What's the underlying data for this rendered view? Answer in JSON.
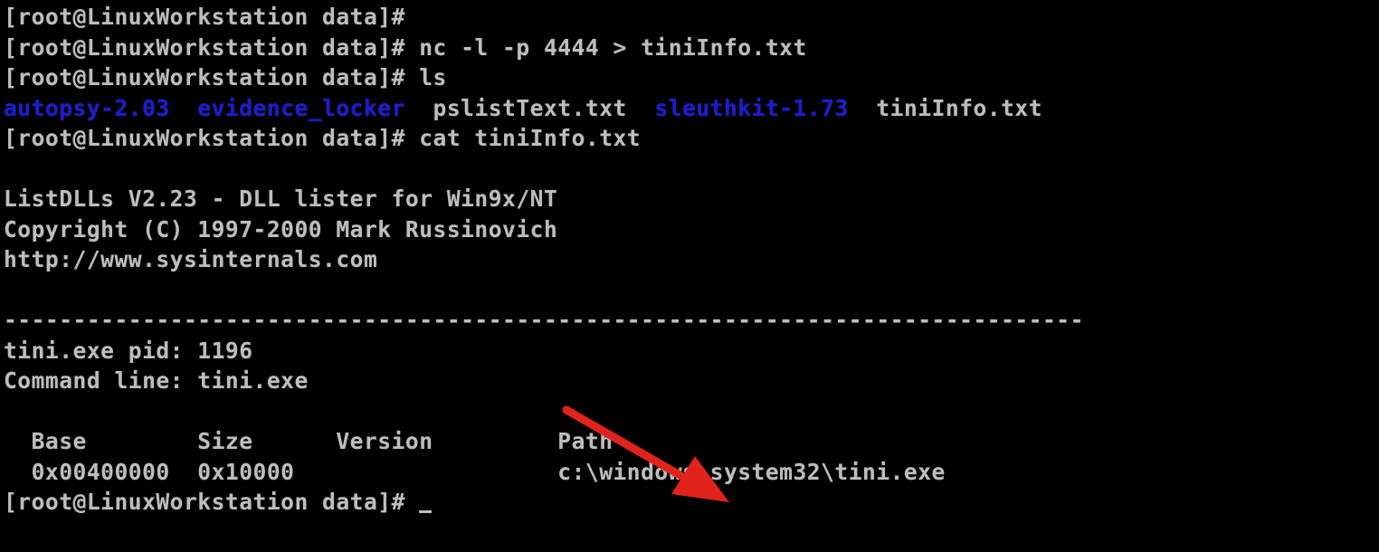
{
  "terminal": {
    "lines": [
      {
        "parts": [
          {
            "text": "[root@LinuxWorkstation data]#"
          }
        ]
      },
      {
        "parts": [
          {
            "text": "[root@LinuxWorkstation data]# nc -l -p 4444 > tiniInfo.txt"
          }
        ]
      },
      {
        "parts": [
          {
            "text": "[root@LinuxWorkstation data]# ls"
          }
        ]
      },
      {
        "parts": [
          {
            "text": "autopsy-2.03",
            "kind": "dir"
          },
          {
            "text": "  "
          },
          {
            "text": "evidence_locker",
            "kind": "dir"
          },
          {
            "text": "  pslistText.txt  "
          },
          {
            "text": "sleuthkit-1.73",
            "kind": "dir"
          },
          {
            "text": "  tiniInfo.txt"
          }
        ]
      },
      {
        "parts": [
          {
            "text": "[root@LinuxWorkstation data]# cat tiniInfo.txt"
          }
        ]
      },
      {
        "parts": [
          {
            "text": ""
          }
        ]
      },
      {
        "parts": [
          {
            "text": "ListDLLs V2.23 - DLL lister for Win9x/NT"
          }
        ]
      },
      {
        "parts": [
          {
            "text": "Copyright (C) 1997-2000 Mark Russinovich"
          }
        ]
      },
      {
        "parts": [
          {
            "text": "http://www.sysinternals.com"
          }
        ]
      },
      {
        "parts": [
          {
            "text": ""
          }
        ]
      },
      {
        "parts": [
          {
            "text": "------------------------------------------------------------------------------"
          }
        ]
      },
      {
        "parts": [
          {
            "text": "tini.exe pid: 1196"
          }
        ]
      },
      {
        "parts": [
          {
            "text": "Command line: tini.exe"
          }
        ]
      },
      {
        "parts": [
          {
            "text": ""
          }
        ]
      },
      {
        "parts": [
          {
            "text": "  Base        Size      Version         Path"
          }
        ]
      },
      {
        "parts": [
          {
            "text": "  0x00400000  0x10000                   c:\\windows\\system32\\tini.exe"
          }
        ]
      },
      {
        "parts": [
          {
            "text": "[root@LinuxWorkstation data]# "
          }
        ],
        "cursor": true
      }
    ]
  },
  "colors": {
    "text": "#bdbdbd",
    "directory": "#1b1bd8",
    "background": "#000000",
    "annotation_arrow": "#e0231c"
  },
  "annotation": {
    "icon": "red-arrow-icon"
  }
}
